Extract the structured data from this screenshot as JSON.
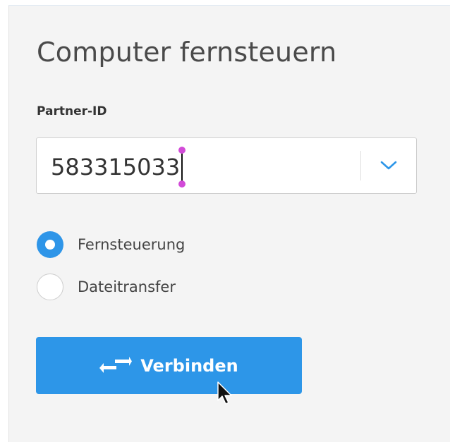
{
  "panel": {
    "title": "Computer fernsteuern"
  },
  "partner": {
    "label": "Partner-ID",
    "value": "583315033",
    "dropdown_icon": "chevron-down-icon"
  },
  "mode": {
    "options": [
      {
        "label": "Fernsteuerung",
        "selected": true
      },
      {
        "label": "Dateitransfer",
        "selected": false
      }
    ]
  },
  "connect": {
    "label": "Verbinden",
    "icon": "swap-arrows-icon"
  },
  "colors": {
    "accent": "#2d96e8",
    "panel_bg": "#f4f4f4"
  }
}
